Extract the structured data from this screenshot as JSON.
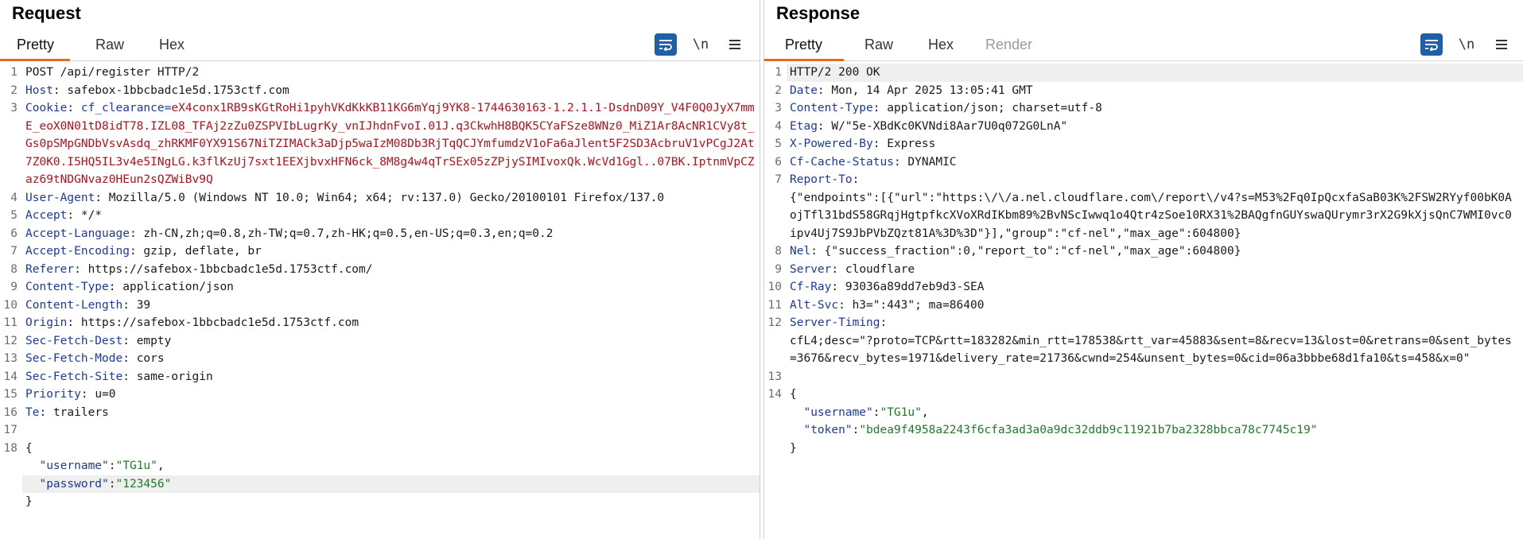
{
  "colors": {
    "accent_underline": "#e8661e",
    "header_name": "#1d3a9a",
    "cookie_value": "#b1111e",
    "json_string": "#1f7a2a",
    "wrap_button": "#1f5fa8"
  },
  "request": {
    "title": "Request",
    "tabs": [
      "Pretty",
      "Raw",
      "Hex"
    ],
    "active_tab": "Pretty",
    "toolbar": {
      "wrap_icon": "text-wrap-icon",
      "newline_label": "\\n",
      "menu_icon": "hamburger-menu-icon"
    },
    "lines": [
      {
        "n": "1",
        "plain": "POST /api/register HTTP/2"
      },
      {
        "n": "2",
        "name": "Host",
        "value": "safebox-1bbcbadc1e5d.1753ctf.com"
      },
      {
        "n": "3",
        "name": "Cookie",
        "cookie_name": "cf_clearance=",
        "cookie_value": "eX4conx1RB9sKGtRoHi1pyhVKdKkKB11KG6mYqj9YK8-1744630163-1.2.1.1-DsdnD09Y_V4F0Q0JyX7mmE_eoX0N01tD8idT78.IZL08_TFAj2zZu0ZSPVIbLugrKy_vnIJhdnFvoI.01J.q3CkwhH8BQK5CYaFSze8WNz0_MiZ1Ar8AcNR1CVy8t_Gs0pSMpGNDbVsvAsdq_zhRKMF0YX91S67NiTZIMACk3aDjp5waIzM08Db3RjTqQCJYmfumdzV1oFa6aJlent5F2SD3AcbruV1vPCgJ2At7Z0K0.I5HQ5IL3v4e5INgLG.k3flKzUj7sxt1EEXjbvxHFN6ck_8M8g4w4qTrSEx05zZPjySIMIvoxQk.WcVd1Ggl..07BK.IptnmVpCZaz69tNDGNvaz0HEun2sQZWiBv9Q"
      },
      {
        "n": "4",
        "name": "User-Agent",
        "value": "Mozilla/5.0 (Windows NT 10.0; Win64; x64; rv:137.0) Gecko/20100101 Firefox/137.0"
      },
      {
        "n": "5",
        "name": "Accept",
        "value": "*/*"
      },
      {
        "n": "6",
        "name": "Accept-Language",
        "value": "zh-CN,zh;q=0.8,zh-TW;q=0.7,zh-HK;q=0.5,en-US;q=0.3,en;q=0.2"
      },
      {
        "n": "7",
        "name": "Accept-Encoding",
        "value": "gzip, deflate, br"
      },
      {
        "n": "8",
        "name": "Referer",
        "value": "https://safebox-1bbcbadc1e5d.1753ctf.com/"
      },
      {
        "n": "9",
        "name": "Content-Type",
        "value": "application/json"
      },
      {
        "n": "10",
        "name": "Content-Length",
        "value": "39"
      },
      {
        "n": "11",
        "name": "Origin",
        "value": "https://safebox-1bbcbadc1e5d.1753ctf.com"
      },
      {
        "n": "12",
        "name": "Sec-Fetch-Dest",
        "value": "empty"
      },
      {
        "n": "13",
        "name": "Sec-Fetch-Mode",
        "value": "cors"
      },
      {
        "n": "14",
        "name": "Sec-Fetch-Site",
        "value": "same-origin"
      },
      {
        "n": "15",
        "name": "Priority",
        "value": "u=0"
      },
      {
        "n": "16",
        "name": "Te",
        "value": "trailers"
      },
      {
        "n": "17",
        "plain": ""
      },
      {
        "n": "18",
        "plain": "{"
      },
      {
        "n": "",
        "jkey": "\"username\"",
        "jval": "\"TG1u\"",
        "comma": ","
      },
      {
        "n": "",
        "jkey": "\"password\"",
        "jval": "\"123456\"",
        "comma": "",
        "highlight": true
      },
      {
        "n": "",
        "plain": "}"
      }
    ]
  },
  "response": {
    "title": "Response",
    "tabs": [
      "Pretty",
      "Raw",
      "Hex",
      "Render"
    ],
    "active_tab": "Pretty",
    "disabled_tab": "Render",
    "toolbar": {
      "wrap_icon": "text-wrap-icon",
      "newline_label": "\\n",
      "menu_icon": "hamburger-menu-icon"
    },
    "lines": [
      {
        "n": "1",
        "plain": "HTTP/2 200 OK",
        "highlight": true
      },
      {
        "n": "2",
        "name": "Date",
        "value": "Mon, 14 Apr 2025 13:05:41 GMT"
      },
      {
        "n": "3",
        "name": "Content-Type",
        "value": "application/json; charset=utf-8"
      },
      {
        "n": "4",
        "name": "Etag",
        "value": "W/\"5e-XBdKc0KVNdi8Aar7U0q072G0LnA\""
      },
      {
        "n": "5",
        "name": "X-Powered-By",
        "value": "Express"
      },
      {
        "n": "6",
        "name": "Cf-Cache-Status",
        "value": "DYNAMIC"
      },
      {
        "n": "7",
        "name": "Report-To",
        "value": ""
      },
      {
        "n": "",
        "plain": "{\"endpoints\":[{\"url\":\"https:\\/\\/a.nel.cloudflare.com\\/report\\/v4?s=M53%2Fq0IpQcxfaSaB03K%2FSW2RYyf00bK0AojTfl31bdS58GRqjHgtpfkcXVoXRdIKbm89%2BvNScIwwq1o4Qtr4zSoe10RX31%2BAQgfnGUYswaQUrymr3rX2G9kXjsQnC7WMI0vc0ipv4Uj7S9JbPVbZQzt81A%3D%3D\"}],\"group\":\"cf-nel\",\"max_age\":604800}"
      },
      {
        "n": "8",
        "name": "Nel",
        "value": "{\"success_fraction\":0,\"report_to\":\"cf-nel\",\"max_age\":604800}"
      },
      {
        "n": "9",
        "name": "Server",
        "value": "cloudflare"
      },
      {
        "n": "10",
        "name": "Cf-Ray",
        "value": "93036a89dd7eb9d3-SEA"
      },
      {
        "n": "11",
        "name": "Alt-Svc",
        "value": "h3=\":443\"; ma=86400"
      },
      {
        "n": "12",
        "name": "Server-Timing",
        "value": ""
      },
      {
        "n": "",
        "plain": "cfL4;desc=\"?proto=TCP&rtt=183282&min_rtt=178538&rtt_var=45883&sent=8&recv=13&lost=0&retrans=0&sent_bytes=3676&recv_bytes=1971&delivery_rate=21736&cwnd=254&unsent_bytes=0&cid=06a3bbbe68d1fa10&ts=458&x=0\""
      },
      {
        "n": "13",
        "plain": ""
      },
      {
        "n": "14",
        "plain": "{"
      },
      {
        "n": "",
        "jkey": "\"username\"",
        "jval": "\"TG1u\"",
        "comma": ","
      },
      {
        "n": "",
        "jkey": "\"token\"",
        "jval": "\"bdea9f4958a2243f6cfa3ad3a0a9dc32ddb9c11921b7ba2328bbca78c7745c19\"",
        "comma": ""
      },
      {
        "n": "",
        "plain": "}"
      }
    ]
  }
}
